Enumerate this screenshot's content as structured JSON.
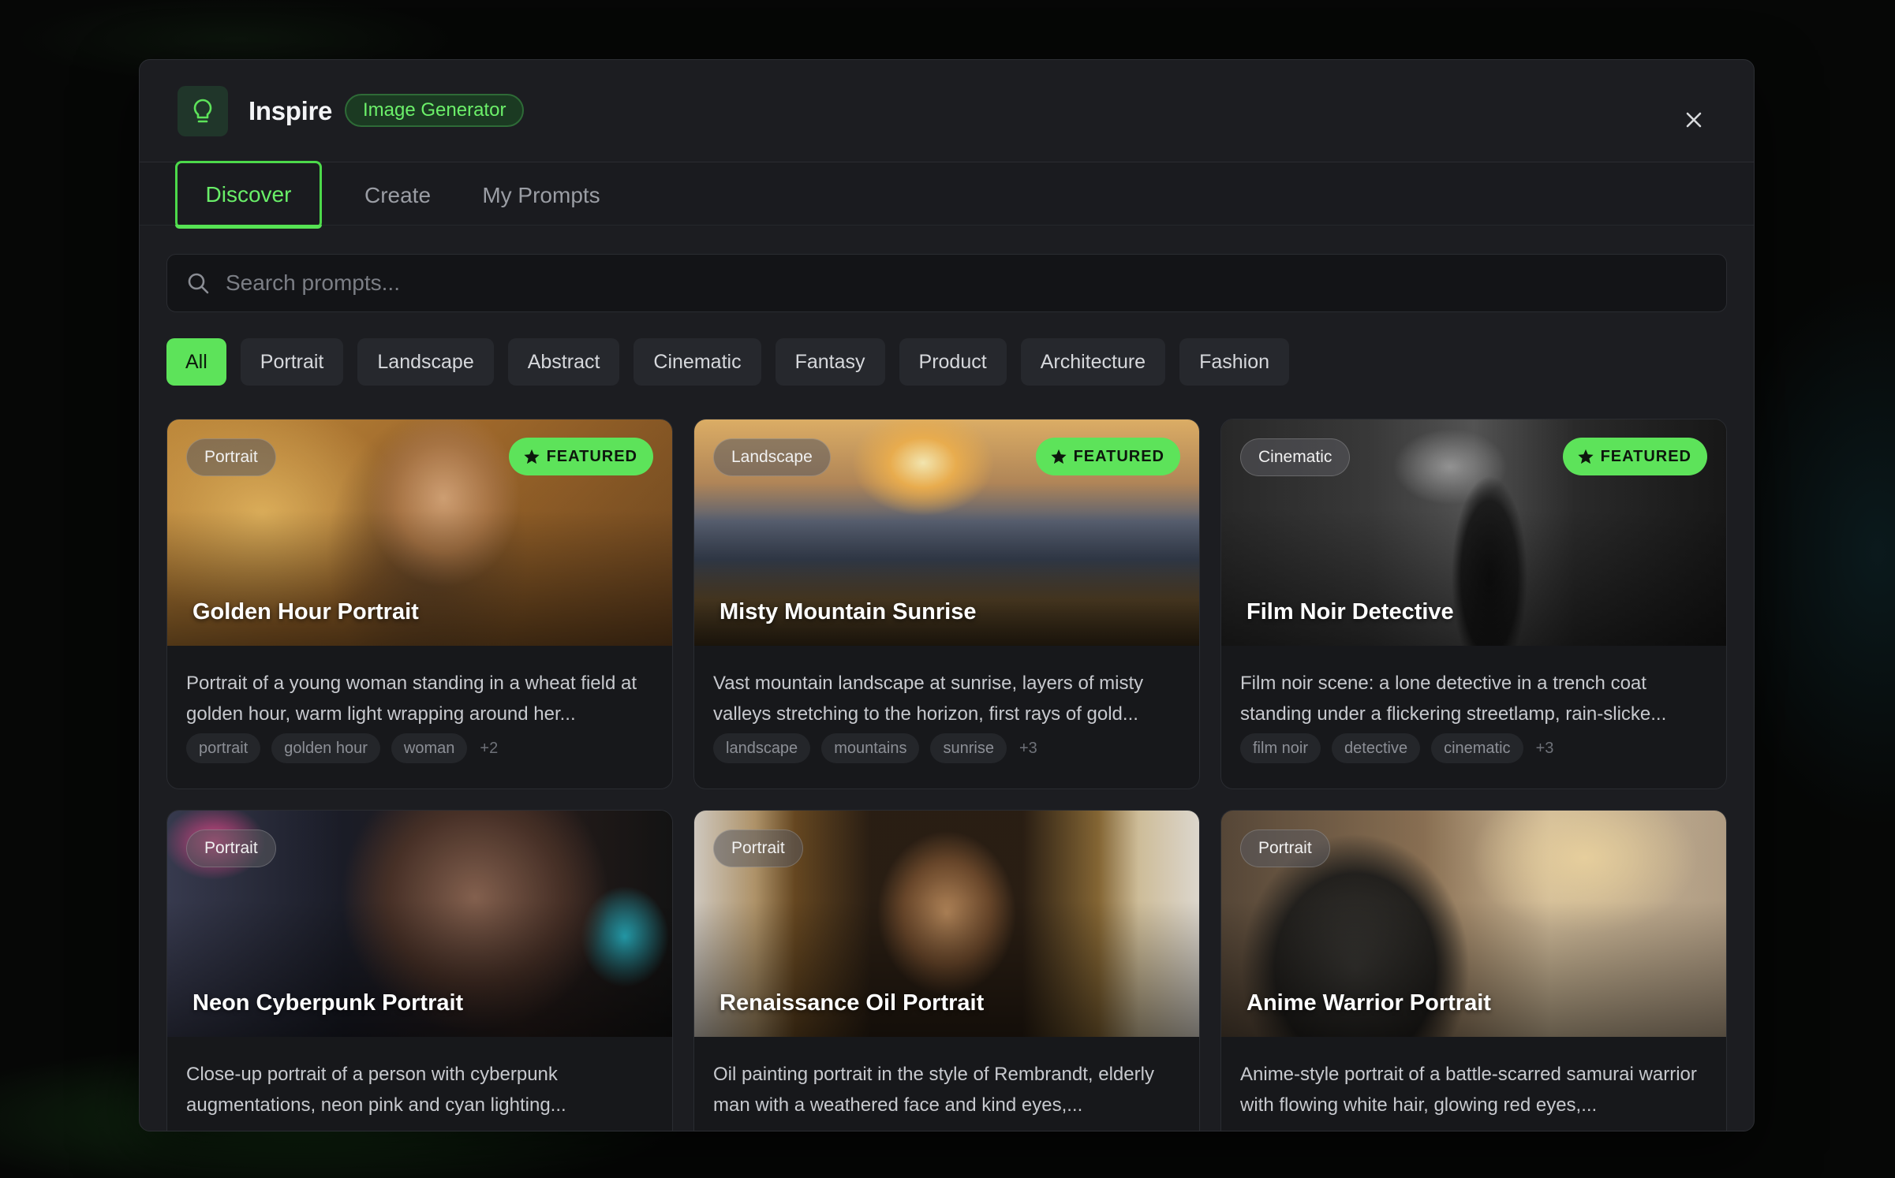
{
  "header": {
    "title": "Inspire",
    "badge": "Image Generator"
  },
  "tabs": [
    {
      "label": "Discover",
      "active": true
    },
    {
      "label": "Create",
      "active": false
    },
    {
      "label": "My Prompts",
      "active": false
    }
  ],
  "search": {
    "placeholder": "Search prompts..."
  },
  "filters": [
    {
      "label": "All",
      "active": true
    },
    {
      "label": "Portrait"
    },
    {
      "label": "Landscape"
    },
    {
      "label": "Abstract"
    },
    {
      "label": "Cinematic"
    },
    {
      "label": "Fantasy"
    },
    {
      "label": "Product"
    },
    {
      "label": "Architecture"
    },
    {
      "label": "Fashion"
    }
  ],
  "featured_label": "FEATURED",
  "cards": [
    {
      "category": "Portrait",
      "featured": true,
      "title": "Golden Hour Portrait",
      "description": "Portrait of a young woman standing in a wheat field at golden hour, warm light wrapping around her...",
      "tags": [
        "portrait",
        "golden hour",
        "woman"
      ],
      "more": "+2"
    },
    {
      "category": "Landscape",
      "featured": true,
      "title": "Misty Mountain Sunrise",
      "description": "Vast mountain landscape at sunrise, layers of misty valleys stretching to the horizon, first rays of gold...",
      "tags": [
        "landscape",
        "mountains",
        "sunrise"
      ],
      "more": "+3"
    },
    {
      "category": "Cinematic",
      "featured": true,
      "title": "Film Noir Detective",
      "description": "Film noir scene: a lone detective in a trench coat standing under a flickering streetlamp, rain-slicke...",
      "tags": [
        "film noir",
        "detective",
        "cinematic"
      ],
      "more": "+3"
    },
    {
      "category": "Portrait",
      "featured": false,
      "title": "Neon Cyberpunk Portrait",
      "description": "Close-up portrait of a person with cyberpunk augmentations, neon pink and cyan lighting...",
      "tags": [],
      "more": ""
    },
    {
      "category": "Portrait",
      "featured": false,
      "title": "Renaissance Oil Portrait",
      "description": "Oil painting portrait in the style of Rembrandt, elderly man with a weathered face and kind eyes,...",
      "tags": [],
      "more": ""
    },
    {
      "category": "Portrait",
      "featured": false,
      "title": "Anime Warrior Portrait",
      "description": "Anime-style portrait of a battle-scarred samurai warrior with flowing white hair, glowing red eyes,...",
      "tags": [],
      "more": ""
    }
  ],
  "colors": {
    "accent": "#5de35a",
    "modal_bg": "#1c1d21"
  }
}
